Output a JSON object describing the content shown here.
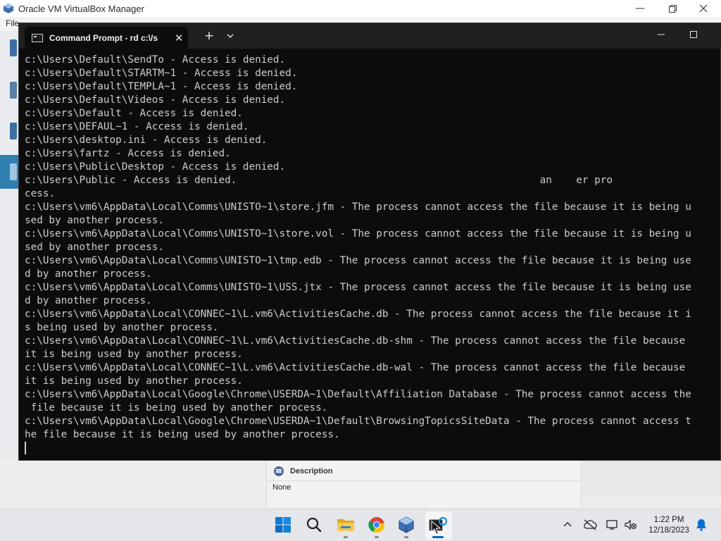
{
  "vbox": {
    "title": "Oracle VM VirtualBox Manager",
    "menu_file": "File",
    "description_title": "Description",
    "description_value": "None"
  },
  "cmd": {
    "tab_title": "Command Prompt - rd  c:\\/s",
    "new_tab_label": "+",
    "close_label": "✕",
    "lines": [
      "c:\\Users\\Default\\SendTo - Access is denied.",
      "c:\\Users\\Default\\STARTM~1 - Access is denied.",
      "c:\\Users\\Default\\TEMPLA~1 - Access is denied.",
      "c:\\Users\\Default\\Videos - Access is denied.",
      "c:\\Users\\Default - Access is denied.",
      "c:\\Users\\DEFAUL~1 - Access is denied.",
      "c:\\Users\\desktop.ini - Access is denied.",
      "c:\\Users\\fartz - Access is denied.",
      "c:\\Users\\Public\\Desktop - Access is denied.",
      "c:\\Users\\Public - Access is denied.                                                  an    er pro",
      "cess.",
      "c:\\Users\\vm6\\AppData\\Local\\Comms\\UNISTO~1\\store.jfm - The process cannot access the file because it is being u",
      "sed by another process.",
      "c:\\Users\\vm6\\AppData\\Local\\Comms\\UNISTO~1\\store.vol - The process cannot access the file because it is being u",
      "sed by another process.",
      "c:\\Users\\vm6\\AppData\\Local\\Comms\\UNISTO~1\\tmp.edb - The process cannot access the file because it is being use",
      "d by another process.",
      "c:\\Users\\vm6\\AppData\\Local\\Comms\\UNISTO~1\\USS.jtx - The process cannot access the file because it is being use",
      "d by another process.",
      "c:\\Users\\vm6\\AppData\\Local\\CONNEC~1\\L.vm6\\ActivitiesCache.db - The process cannot access the file because it i",
      "s being used by another process.",
      "c:\\Users\\vm6\\AppData\\Local\\CONNEC~1\\L.vm6\\ActivitiesCache.db-shm - The process cannot access the file because",
      "it is being used by another process.",
      "c:\\Users\\vm6\\AppData\\Local\\CONNEC~1\\L.vm6\\ActivitiesCache.db-wal - The process cannot access the file because",
      "it is being used by another process.",
      "c:\\Users\\vm6\\AppData\\Local\\Google\\Chrome\\USERDA~1\\Default\\Affiliation Database - The process cannot access the",
      " file because it is being used by another process.",
      "c:\\Users\\vm6\\AppData\\Local\\Google\\Chrome\\USERDA~1\\Default\\BrowsingTopicsSiteData - The process cannot access t",
      "he file because it is being used by another process."
    ]
  },
  "taskbar": {
    "time": "1:22 PM",
    "date": "12/18/2023",
    "icons": [
      "windows-start",
      "search",
      "file-explorer",
      "chrome",
      "virtualbox",
      "terminal"
    ]
  },
  "colors": {
    "terminal_bg": "#0c0c0c",
    "terminal_text": "#cccccc",
    "accent": "#0067c0"
  }
}
